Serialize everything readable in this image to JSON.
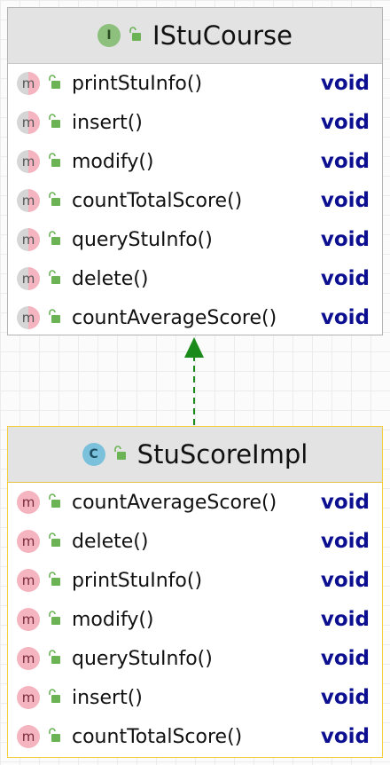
{
  "interface_box": {
    "badge": "I",
    "title": "IStuCourse",
    "methods": [
      {
        "name": "printStuInfo()",
        "type": "void"
      },
      {
        "name": "insert()",
        "type": "void"
      },
      {
        "name": "modify()",
        "type": "void"
      },
      {
        "name": "countTotalScore()",
        "type": "void"
      },
      {
        "name": "queryStuInfo()",
        "type": "void"
      },
      {
        "name": "delete()",
        "type": "void"
      },
      {
        "name": "countAverageScore()",
        "type": "void"
      }
    ]
  },
  "class_box": {
    "badge": "C",
    "title": "StuScoreImpl",
    "methods": [
      {
        "name": "countAverageScore()",
        "type": "void"
      },
      {
        "name": "delete()",
        "type": "void"
      },
      {
        "name": "printStuInfo()",
        "type": "void"
      },
      {
        "name": "modify()",
        "type": "void"
      },
      {
        "name": "queryStuInfo()",
        "type": "void"
      },
      {
        "name": "insert()",
        "type": "void"
      },
      {
        "name": "countTotalScore()",
        "type": "void"
      }
    ]
  },
  "method_badge": "m",
  "relation": {
    "type": "implements",
    "color": "#1a8a1a",
    "style": "dashed"
  },
  "colors": {
    "interface_border": "#b3b3b3",
    "class_border": "#f5cd3a",
    "return_type": "#0c0f8f",
    "method_badge": "#f4b5c0",
    "lock": "#6cb356"
  }
}
